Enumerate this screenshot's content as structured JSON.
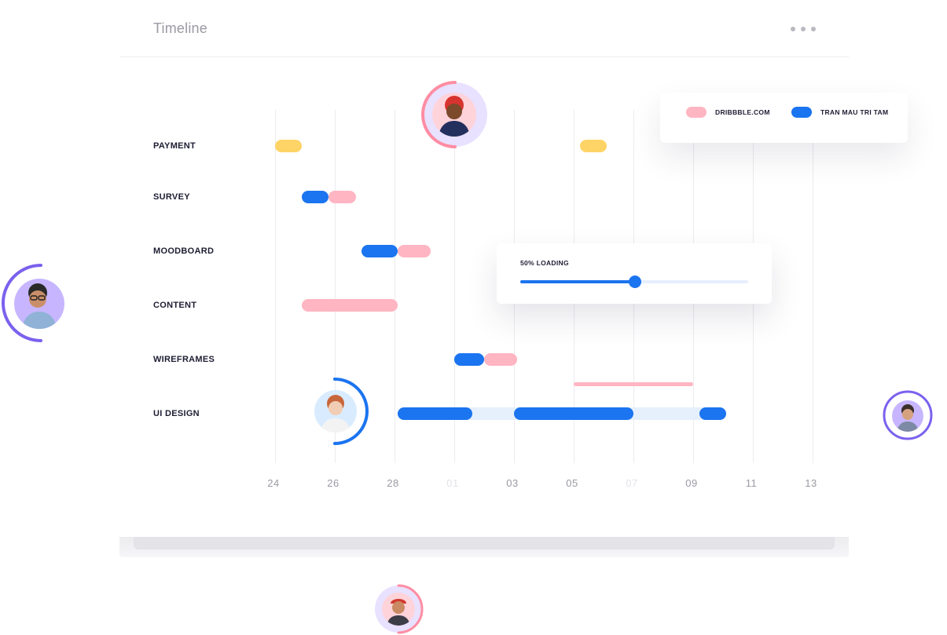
{
  "header": {
    "title": "Timeline",
    "more_icon": "more-horizontal-icon"
  },
  "legend": [
    {
      "label": "DRIBBBLE.COM",
      "color": "#ffb5c2"
    },
    {
      "label": "TRAN MAU TRI TAM",
      "color": "#1b74f0"
    }
  ],
  "loading": {
    "label": "50% LOADING",
    "value": 0.5
  },
  "colors": {
    "blue": "#1b74f0",
    "pink": "#ffb5c2",
    "yellow": "#ffd466",
    "track": "#e6effc",
    "avatar_purple": "#c7b6ff",
    "ring_purple": "#7b61ee",
    "ring_pink": "#ff8da3",
    "ring_blue": "#1b74f0"
  },
  "chart_data": {
    "type": "gantt",
    "x_ticks": [
      "24",
      "26",
      "28",
      "01",
      "03",
      "05",
      "07",
      "09",
      "11",
      "13"
    ],
    "faded_ticks": [
      "01",
      "07"
    ],
    "rows": [
      {
        "label": "PAYMENT",
        "segments": [
          {
            "start": 0,
            "end": 0.9,
            "color": "yellow"
          },
          {
            "start": 10.2,
            "end": 11.1,
            "color": "yellow"
          }
        ]
      },
      {
        "label": "SURVEY",
        "segments": [
          {
            "start": 1.8,
            "end": 2.7,
            "color": "pink"
          },
          {
            "start": 0.9,
            "end": 1.8,
            "color": "blue"
          }
        ]
      },
      {
        "label": "MOODBOARD",
        "segments": [
          {
            "start": 4.1,
            "end": 5.2,
            "color": "pink"
          },
          {
            "start": 2.9,
            "end": 4.1,
            "color": "blue"
          }
        ]
      },
      {
        "label": "CONTENT",
        "segments": [
          {
            "start": 0.9,
            "end": 4.1,
            "color": "pink"
          }
        ]
      },
      {
        "label": "WIREFRAMES",
        "segments": [
          {
            "start": 7.0,
            "end": 8.1,
            "color": "pink"
          },
          {
            "start": 6.0,
            "end": 7.0,
            "color": "blue"
          }
        ]
      },
      {
        "label": "UI DESIGN",
        "segments": [
          {
            "start": 4.1,
            "end": 15.1,
            "color": "track"
          },
          {
            "start": 4.1,
            "end": 6.6,
            "color": "blue"
          },
          {
            "start": 8.0,
            "end": 12.0,
            "color": "blue"
          },
          {
            "start": 14.2,
            "end": 15.1,
            "color": "blue"
          }
        ]
      }
    ],
    "extra_segments": [
      {
        "row_offset": 4.4,
        "start": 10.0,
        "end": 14.0,
        "color": "pink",
        "thin": true
      }
    ]
  },
  "avatars": [
    {
      "name": "avatar-woman-red-hair"
    },
    {
      "name": "avatar-man-glasses"
    },
    {
      "name": "avatar-woman-ginger"
    },
    {
      "name": "avatar-man-right"
    },
    {
      "name": "avatar-man-cap"
    }
  ]
}
